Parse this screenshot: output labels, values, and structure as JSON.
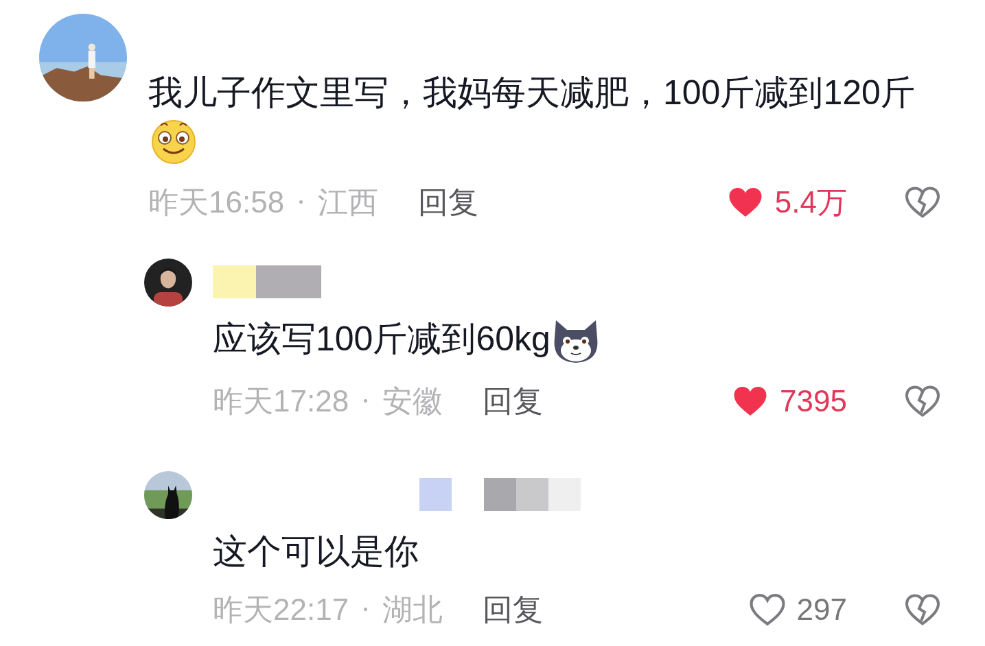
{
  "comments": [
    {
      "text": "我儿子作文里写，我妈每天减肥，100斤减到120斤",
      "name_hidden": false,
      "time": "昨天16:58",
      "region": "江西",
      "reply": "回复",
      "likes": "5.4万",
      "liked": true,
      "is_reply": false
    },
    {
      "text": "应该写100斤减到60kg",
      "name_hidden": true,
      "time": "昨天17:28",
      "region": "安徽",
      "reply": "回复",
      "likes": "7395",
      "liked": true,
      "is_reply": true
    },
    {
      "text": "这个可以是你",
      "name_hidden": true,
      "time": "昨天22:17",
      "region": "湖北",
      "reply": "回复",
      "likes": "297",
      "liked": false,
      "is_reply": true
    }
  ]
}
